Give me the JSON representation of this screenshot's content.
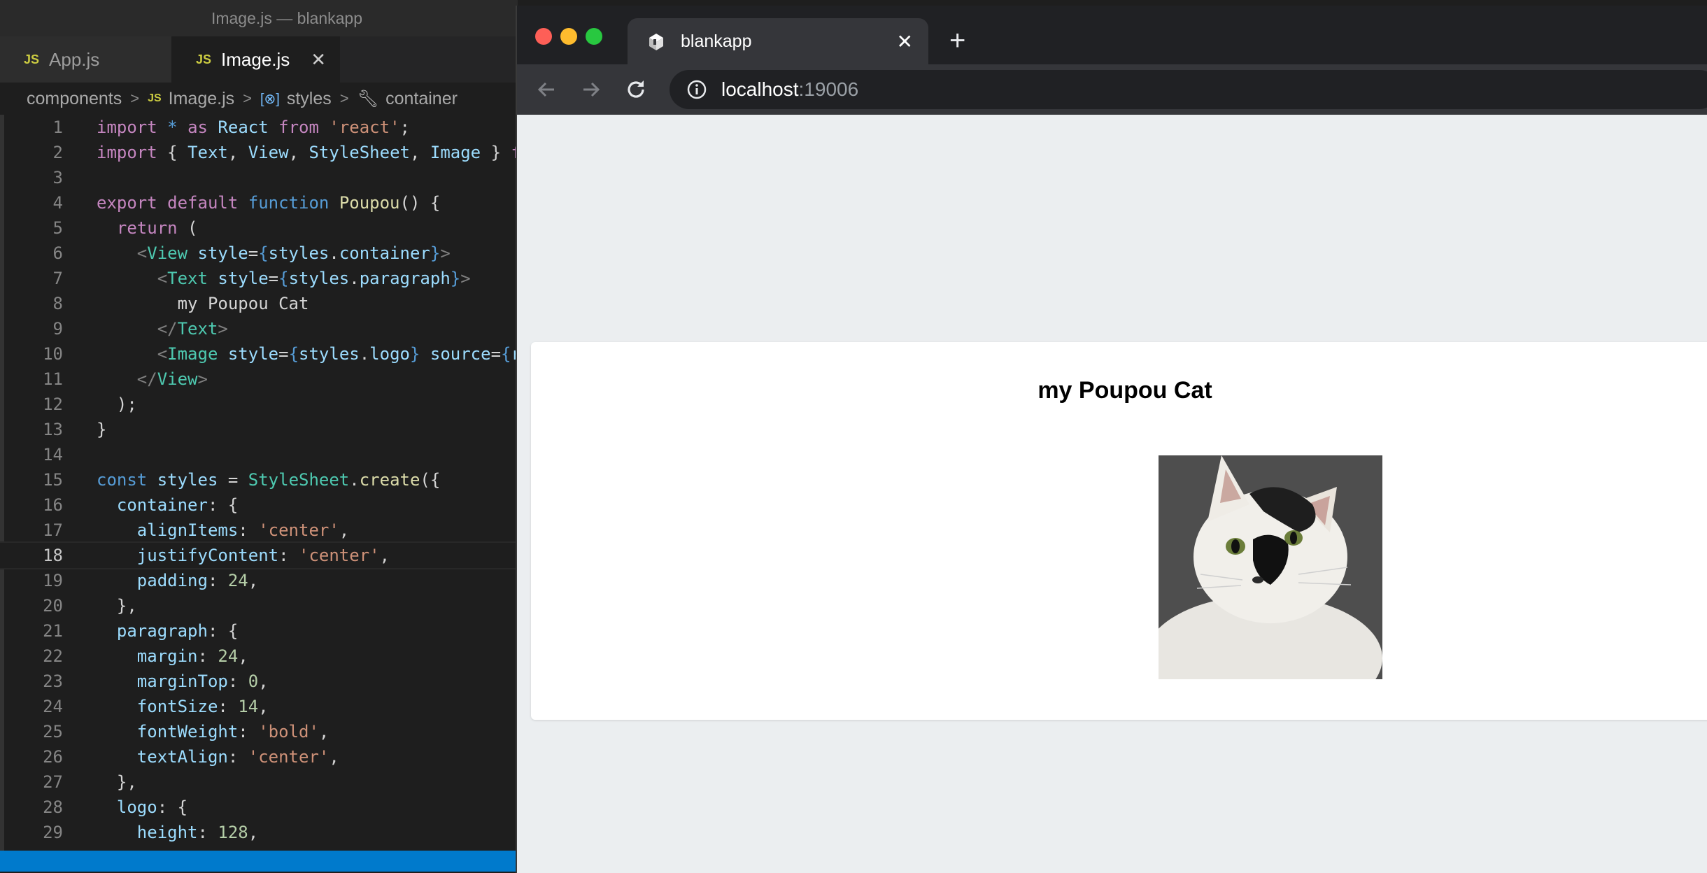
{
  "editor": {
    "window_title": "Image.js — blankapp",
    "tabs": [
      {
        "badge": "JS",
        "label": "App.js"
      },
      {
        "badge": "JS",
        "label": "Image.js",
        "close": "✕"
      }
    ],
    "breadcrumb": {
      "folder": "components",
      "file_badge": "JS",
      "file": "Image.js",
      "symbol1": "styles",
      "symbol2": "container"
    },
    "code_lines": [
      {
        "n": "1",
        "html": "<span class='kw'>import</span> <span class='kb'>*</span> <span class='kw'>as</span> <span class='prop'>React</span> <span class='kw'>from</span> <span class='str'>'react'</span>;"
      },
      {
        "n": "2",
        "html": "<span class='kw'>import</span> { <span class='prop'>Text</span>, <span class='prop'>View</span>, <span class='prop'>StyleSheet</span>, <span class='prop'>Image</span> } <span class='kw'>f</span>"
      },
      {
        "n": "3",
        "html": ""
      },
      {
        "n": "4",
        "html": "<span class='kw'>export</span> <span class='kw'>default</span> <span class='kb'>function</span> <span class='fn'>Poupou</span>() {"
      },
      {
        "n": "5",
        "html": "  <span class='kw'>return</span> ("
      },
      {
        "n": "6",
        "html": "    <span class='tag'>&lt;</span><span class='tagn'>View</span> <span class='prop'>style</span>=<span class='brace'>{</span><span class='prop'>styles</span>.<span class='prop'>container</span><span class='brace'>}</span><span class='tag'>&gt;</span>"
      },
      {
        "n": "7",
        "html": "      <span class='tag'>&lt;</span><span class='tagn'>Text</span> <span class='prop'>style</span>=<span class='brace'>{</span><span class='prop'>styles</span>.<span class='prop'>paragraph</span><span class='brace'>}</span><span class='tag'>&gt;</span>"
      },
      {
        "n": "8",
        "html": "        my Poupou Cat"
      },
      {
        "n": "9",
        "html": "      <span class='tag'>&lt;/</span><span class='tagn'>Text</span><span class='tag'>&gt;</span>"
      },
      {
        "n": "10",
        "html": "      <span class='tag'>&lt;</span><span class='tagn'>Image</span> <span class='prop'>style</span>=<span class='brace'>{</span><span class='prop'>styles</span>.<span class='prop'>logo</span><span class='brace'>}</span> <span class='prop'>source</span>=<span class='brace'>{</span><span class='prop'>r</span>"
      },
      {
        "n": "11",
        "html": "    <span class='tag'>&lt;/</span><span class='tagn'>View</span><span class='tag'>&gt;</span>"
      },
      {
        "n": "12",
        "html": "  );"
      },
      {
        "n": "13",
        "html": "}"
      },
      {
        "n": "14",
        "html": ""
      },
      {
        "n": "15",
        "html": "<span class='kb'>const</span> <span class='prop'>styles</span> = <span class='cls'>StyleSheet</span>.<span class='fn'>create</span>({"
      },
      {
        "n": "16",
        "html": "  <span class='prop'>container</span>: {"
      },
      {
        "n": "17",
        "html": "    <span class='prop'>alignItems</span>: <span class='str'>'center'</span>,"
      },
      {
        "n": "18",
        "html": "    <span class='prop'>justifyContent</span>: <span class='str'>'center'</span>,"
      },
      {
        "n": "19",
        "html": "    <span class='prop'>padding</span>: <span class='num'>24</span>,"
      },
      {
        "n": "20",
        "html": "  },"
      },
      {
        "n": "21",
        "html": "  <span class='prop'>paragraph</span>: {"
      },
      {
        "n": "22",
        "html": "    <span class='prop'>margin</span>: <span class='num'>24</span>,"
      },
      {
        "n": "23",
        "html": "    <span class='prop'>marginTop</span>: <span class='num'>0</span>,"
      },
      {
        "n": "24",
        "html": "    <span class='prop'>fontSize</span>: <span class='num'>14</span>,"
      },
      {
        "n": "25",
        "html": "    <span class='prop'>fontWeight</span>: <span class='str'>'bold'</span>,"
      },
      {
        "n": "26",
        "html": "    <span class='prop'>textAlign</span>: <span class='str'>'center'</span>,"
      },
      {
        "n": "27",
        "html": "  },"
      },
      {
        "n": "28",
        "html": "  <span class='prop'>logo</span>: {"
      },
      {
        "n": "29",
        "html": "    <span class='prop'>height</span>: <span class='num'>128</span>,"
      }
    ],
    "current_line": "18",
    "colors": {
      "statusbar": "#007acc",
      "background": "#1e1e1e"
    }
  },
  "browser": {
    "tab_title": "blankapp",
    "tab_close": "✕",
    "new_tab": "+",
    "url_host": "localhost",
    "url_port": ":19006",
    "page": {
      "heading": "my Poupou Cat",
      "image_subject": "black and white cat photo"
    },
    "icons": [
      "back-arrow-icon",
      "forward-arrow-icon",
      "reload-icon",
      "info-icon",
      "expo-favicon-icon"
    ]
  }
}
